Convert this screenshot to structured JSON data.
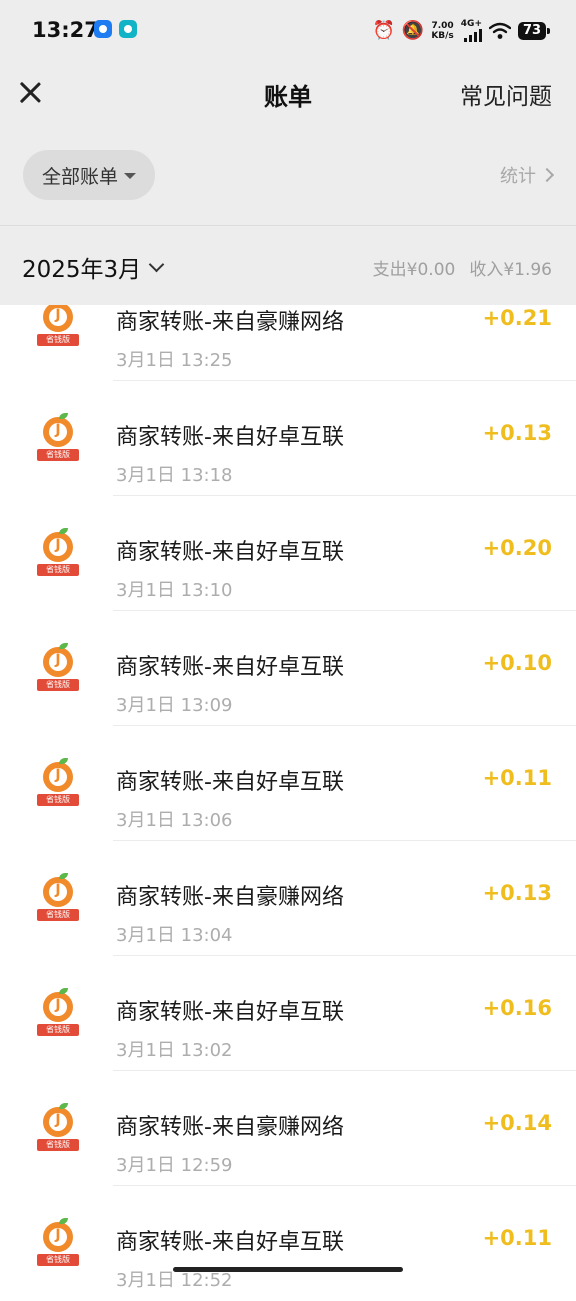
{
  "status_bar": {
    "time": "13:27",
    "net_speed_value": "7.00",
    "net_speed_unit": "KB/s",
    "network_label": "4G+",
    "battery": "73",
    "icons": [
      "alarm-clock-icon",
      "bell-muted-icon",
      "signal-icon",
      "wifi-icon",
      "battery-icon"
    ]
  },
  "header": {
    "title": "账单",
    "faq_label": "常见问题"
  },
  "filter": {
    "selected": "全部账单",
    "stats_label": "统计"
  },
  "month_bar": {
    "month": "2025年3月",
    "expense": "支出¥0.00",
    "income": "收入¥1.96"
  },
  "colors": {
    "background_top": "#ededed",
    "amount": "#f0bd1f",
    "logo_orange": "#f08a2b",
    "logo_badge": "#e24b37"
  },
  "transactions": [
    {
      "title": "商家转账-来自豪赚网络",
      "time": "3月1日 13:25",
      "amount": "+0.21",
      "badge": "省钱版"
    },
    {
      "title": "商家转账-来自好卓互联",
      "time": "3月1日 13:18",
      "amount": "+0.13",
      "badge": "省钱版"
    },
    {
      "title": "商家转账-来自好卓互联",
      "time": "3月1日 13:10",
      "amount": "+0.20",
      "badge": "省钱版"
    },
    {
      "title": "商家转账-来自好卓互联",
      "time": "3月1日 13:09",
      "amount": "+0.10",
      "badge": "省钱版"
    },
    {
      "title": "商家转账-来自好卓互联",
      "time": "3月1日 13:06",
      "amount": "+0.11",
      "badge": "省钱版"
    },
    {
      "title": "商家转账-来自豪赚网络",
      "time": "3月1日 13:04",
      "amount": "+0.13",
      "badge": "省钱版"
    },
    {
      "title": "商家转账-来自好卓互联",
      "time": "3月1日 13:02",
      "amount": "+0.16",
      "badge": "省钱版"
    },
    {
      "title": "商家转账-来自豪赚网络",
      "time": "3月1日 12:59",
      "amount": "+0.14",
      "badge": "省钱版"
    },
    {
      "title": "商家转账-来自好卓互联",
      "time": "3月1日 12:52",
      "amount": "+0.11",
      "badge": "省钱版"
    }
  ]
}
